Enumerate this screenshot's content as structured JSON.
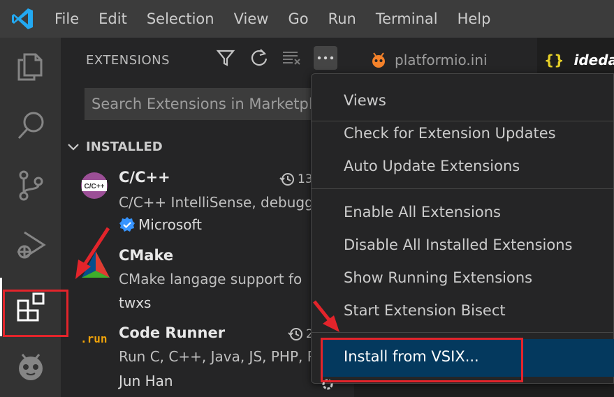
{
  "menubar": {
    "items": [
      "File",
      "Edit",
      "Selection",
      "View",
      "Go",
      "Run",
      "Terminal",
      "Help"
    ]
  },
  "activity_bar": {
    "icons": [
      "explorer-icon",
      "search-icon",
      "source-control-icon",
      "run-debug-icon",
      "extensions-icon",
      "platformio-icon"
    ],
    "active": "extensions-icon"
  },
  "sidebar": {
    "title": "EXTENSIONS",
    "search_placeholder": "Search Extensions in Marketplace",
    "section": "INSTALLED",
    "extensions": [
      {
        "name": "C/C++",
        "description": "C/C++ IntelliSense, debugg",
        "publisher": "Microsoft",
        "verified": true,
        "meta": "13",
        "icon_text": "C/C++"
      },
      {
        "name": "CMake",
        "description": "CMake langage support fo",
        "publisher": "twxs",
        "verified": false,
        "meta": ""
      },
      {
        "name": "Code Runner",
        "description": "Run C, C++, Java, JS, PHP, P",
        "publisher": "Jun Han",
        "verified": false,
        "meta": "2",
        "icon_text": ".run"
      }
    ]
  },
  "editor": {
    "tabs": [
      {
        "label": "platformio.ini",
        "active": false
      },
      {
        "label": "idedata",
        "icon_text": "{}",
        "active": true
      }
    ]
  },
  "context_menu": {
    "groups": [
      [
        "Views"
      ],
      [
        "Check for Extension Updates",
        "Auto Update Extensions"
      ],
      [
        "Enable All Extensions",
        "Disable All Installed Extensions",
        "Show Running Extensions",
        "Start Extension Bisect"
      ],
      [
        "Install from VSIX..."
      ]
    ],
    "items": [
      "Views",
      "Check for Extension Updates",
      "Auto Update Extensions",
      "Enable All Extensions",
      "Disable All Installed Extensions",
      "Show Running Extensions",
      "Start Extension Bisect",
      "Install from VSIX..."
    ],
    "highlighted": "Install from VSIX..."
  },
  "colors": {
    "accent_blue": "#007acc",
    "highlight": "#04395e",
    "annotation_red": "#e3242b"
  }
}
